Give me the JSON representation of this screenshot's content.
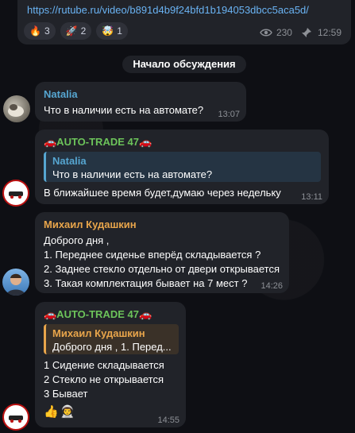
{
  "top_message": {
    "link": "https://rutube.ru/video/b891d4b9f24bfd1b194053dbcc5aca5d/",
    "reactions": [
      {
        "emoji": "🔥",
        "count": "3"
      },
      {
        "emoji": "🚀",
        "count": "2"
      },
      {
        "emoji": "🤯",
        "count": "1"
      }
    ],
    "views": "230",
    "time": "12:59"
  },
  "discussion_start": "Начало обсуждения",
  "messages": [
    {
      "sender": "Natalia",
      "sender_color": "#56a6d1",
      "text": "Что в наличии есть на автомате?",
      "time": "13:07"
    },
    {
      "sender": "🚗AUTO-TRADE 47🚗",
      "sender_color": "#6cc35a",
      "quote_sender": "Natalia",
      "quote_text": "Что в наличии есть на автомате?",
      "text": "В ближайшее время будет,думаю через недельку",
      "time": "13:11"
    },
    {
      "sender": "Михаил Кудашкин",
      "sender_color": "#e8a54b",
      "lines": [
        "Доброго дня ,",
        "1. Переднее сиденье вперёд складывается ?",
        "2. Заднее стекло отдельно от двери открывается",
        "3. Такая комплектация бывает на 7 мест ?"
      ],
      "time": "14:26"
    },
    {
      "sender": "🚗AUTO-TRADE 47🚗",
      "sender_color": "#6cc35a",
      "quote_sender": "Михаил Кудашкин",
      "quote_text": "Доброго дня ,  1. Перед...",
      "lines": [
        "1 Сидение складывается",
        "2 Стекло не открывается",
        "3 Бывает"
      ],
      "reactions": [
        "👍",
        "👨‍🚀"
      ],
      "time": "14:55"
    }
  ],
  "avatar_badge_text": "AUTO-TRADE 47"
}
